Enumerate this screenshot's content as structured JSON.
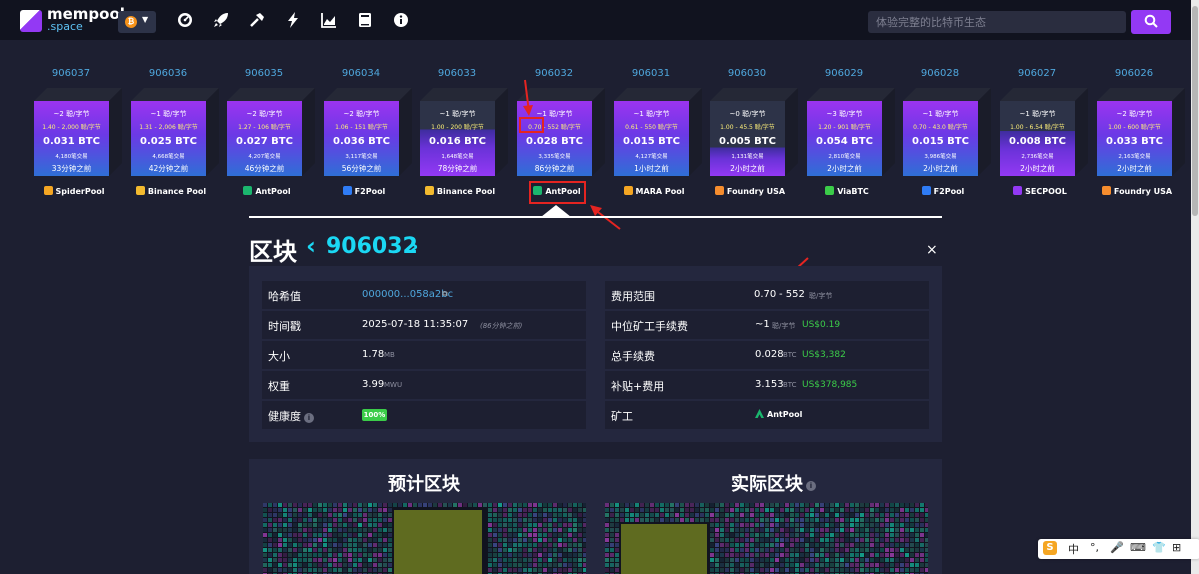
{
  "header": {
    "logo_line1": "mempool",
    "logo_line2": ".space",
    "network_icon": "bitcoin-icon",
    "nav_icons": [
      "dashboard-icon",
      "rocket-icon",
      "mining-hammer-icon",
      "lightning-icon",
      "graphs-icon",
      "docs-icon",
      "about-icon"
    ],
    "search_placeholder": "体验完整的比特币生态"
  },
  "blocks": [
    {
      "height": "906037",
      "fee": "~2 聪/字节",
      "range": "1.40 - 2,000 聪/字节",
      "total": "0.031 BTC",
      "tx": "4,180笔交易",
      "time": "33分钟之前",
      "pool": "SpiderPool",
      "pool_color": "#f5a623",
      "fill": 1.0
    },
    {
      "height": "906036",
      "fee": "~1 聪/字节",
      "range": "1.31 - 2,006 聪/字节",
      "total": "0.025 BTC",
      "tx": "4,668笔交易",
      "time": "42分钟之前",
      "pool": "Binance Pool",
      "pool_color": "#f3ba2f",
      "fill": 1.0
    },
    {
      "height": "906035",
      "fee": "~2 聪/字节",
      "range": "1.27 - 106 聪/字节",
      "total": "0.027 BTC",
      "tx": "4,207笔交易",
      "time": "46分钟之前",
      "pool": "AntPool",
      "pool_color": "#1bb66e",
      "fill": 1.0
    },
    {
      "height": "906034",
      "fee": "~2 聪/字节",
      "range": "1.06 - 151 聪/字节",
      "total": "0.036 BTC",
      "tx": "3,117笔交易",
      "time": "56分钟之前",
      "pool": "F2Pool",
      "pool_color": "#2f7cf6",
      "fill": 1.0
    },
    {
      "height": "906033",
      "fee": "~1 聪/字节",
      "range": "1.00 - 200 聪/字节",
      "total": "0.016 BTC",
      "tx": "1,648笔交易",
      "time": "78分钟之前",
      "pool": "Binance Pool",
      "pool_color": "#f3ba2f",
      "fill": 0.62
    },
    {
      "height": "906032",
      "fee": "~1 聪/字节",
      "range": "0.70 - 552 聪/字节",
      "total": "0.028 BTC",
      "tx": "3,335笔交易",
      "time": "86分钟之前",
      "pool": "AntPool",
      "pool_color": "#1bb66e",
      "fill": 1.0
    },
    {
      "height": "906031",
      "fee": "~1 聪/字节",
      "range": "0.61 - 550 聪/字节",
      "total": "0.015 BTC",
      "tx": "4,127笔交易",
      "time": "1小时之前",
      "pool": "MARA Pool",
      "pool_color": "#f5a623",
      "fill": 1.0
    },
    {
      "height": "906030",
      "fee": "~0 聪/字节",
      "range": "1.00 - 45.5 聪/字节",
      "total": "0.005 BTC",
      "tx": "1,131笔交易",
      "time": "2小时之前",
      "pool": "Foundry USA",
      "pool_color": "#f68d2e",
      "fill": 0.38
    },
    {
      "height": "906029",
      "fee": "~3 聪/字节",
      "range": "1.20 - 901 聪/字节",
      "total": "0.054 BTC",
      "tx": "2,810笔交易",
      "time": "2小时之前",
      "pool": "ViaBTC",
      "pool_color": "#3bcc49",
      "fill": 1.0
    },
    {
      "height": "906028",
      "fee": "~1 聪/字节",
      "range": "0.70 - 43.0 聪/字节",
      "total": "0.015 BTC",
      "tx": "3,986笔交易",
      "time": "2小时之前",
      "pool": "F2Pool",
      "pool_color": "#2f7cf6",
      "fill": 1.0
    },
    {
      "height": "906027",
      "fee": "~1 聪/字节",
      "range": "1.00 - 6.54 聪/字节",
      "total": "0.008 BTC",
      "tx": "2,736笔交易",
      "time": "2小时之前",
      "pool": "SECPOOL",
      "pool_color": "#9339f4",
      "fill": 0.6
    },
    {
      "height": "906026",
      "fee": "~2 聪/字节",
      "range": "1.00 - 600 聪/字节",
      "total": "0.033 BTC",
      "tx": "2,163笔交易",
      "time": "2小时之前",
      "pool": "Foundry USA",
      "pool_color": "#f68d2e",
      "fill": 1.0
    }
  ],
  "block_detail": {
    "title": "区块",
    "prev_symbol": "‹",
    "height": "906032",
    "next_symbol": "›",
    "close_symbol": "×",
    "left": [
      {
        "label": "哈希值",
        "value": "000000...058a2bc",
        "extra": "⧉"
      },
      {
        "label": "时间戳",
        "value": "2025-07-18 11:35:07",
        "extra": "(86分钟之前)"
      },
      {
        "label": "大小",
        "value": "1.78",
        "unit": "MB"
      },
      {
        "label": "权重",
        "value": "3.99",
        "unit": "MWU"
      },
      {
        "label": "健康度",
        "badge": "100%"
      }
    ],
    "right": [
      {
        "label": "费用范围",
        "v1": "0.70",
        "v2": "- 552",
        "unit": "聪/字节"
      },
      {
        "label": "中位矿工手续费",
        "v1": "~1",
        "unit": "聪/字节",
        "usd": "US$0.19"
      },
      {
        "label": "总手续费",
        "v1": "0.028",
        "unit": "BTC",
        "usd": "US$3,382"
      },
      {
        "label": "补贴+费用",
        "v1": "3.153",
        "unit": "BTC",
        "usd": "US$378,985"
      },
      {
        "label": "矿工",
        "v1": "AntPool"
      }
    ]
  },
  "panels": {
    "projected_title": "预计区块",
    "actual_title": "实际区块"
  },
  "tray": {
    "items": [
      "S",
      "中",
      "°,",
      "🎤",
      "⌨",
      "👕",
      "⊞"
    ]
  }
}
